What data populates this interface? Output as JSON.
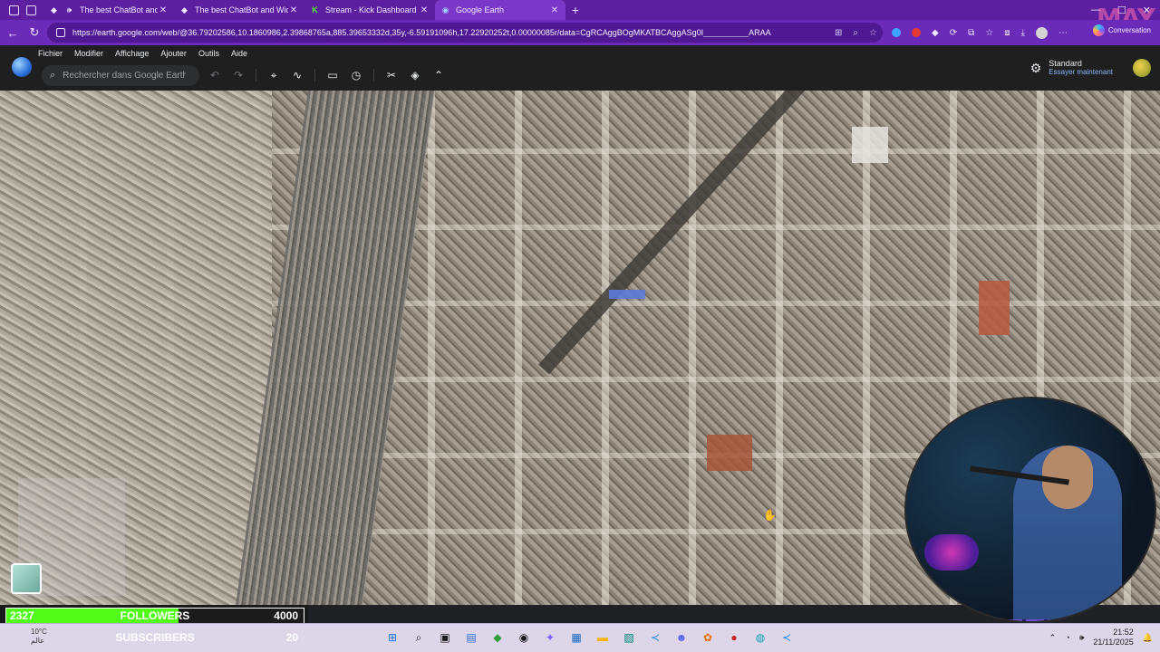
{
  "browser": {
    "tabs": [
      {
        "title": "The best ChatBot and Widgets fo",
        "favicon": "diamond-icon"
      },
      {
        "title": "The best ChatBot and Widgets fo",
        "favicon": "diamond-icon"
      },
      {
        "title": "Stream - Kick Dashboard",
        "favicon": "kick-icon"
      },
      {
        "title": "Google Earth",
        "favicon": "globe-icon",
        "active": true
      }
    ],
    "new_tab_symbol": "+",
    "url": "https://earth.google.com/web/@36.79202586,10.1860986,2.39868765a,885.39653332d,35y,-6.59191096h,17.22920252t,0.00000085r/data=CgRCAggBOgMKATBCAggASg0I__________ARAA",
    "copilot_label": "Conversation"
  },
  "earth": {
    "menu": [
      "Fichier",
      "Modifier",
      "Affichage",
      "Ajouter",
      "Outils",
      "Aide"
    ],
    "search_placeholder": "Rechercher dans Google Earth",
    "mode_title": "Standard",
    "mode_subtitle": "Essayer maintenant"
  },
  "goals": {
    "followers": {
      "current": "2327",
      "label": "FOLLOWERS",
      "target": "4000",
      "progress": 0.58
    },
    "subscribers": {
      "current": "",
      "label": "SUBSCRIBERS",
      "target": "20",
      "progress": 0.0
    }
  },
  "taskbar": {
    "weather_temp": "10°C",
    "weather_desc": "عالم",
    "time": "21:52",
    "date": "21/11/2025"
  },
  "colors": {
    "tab_strip": "#5b1fa0",
    "followers_fill": "#53fc18",
    "subscribers_fill": "#d64dd8"
  }
}
